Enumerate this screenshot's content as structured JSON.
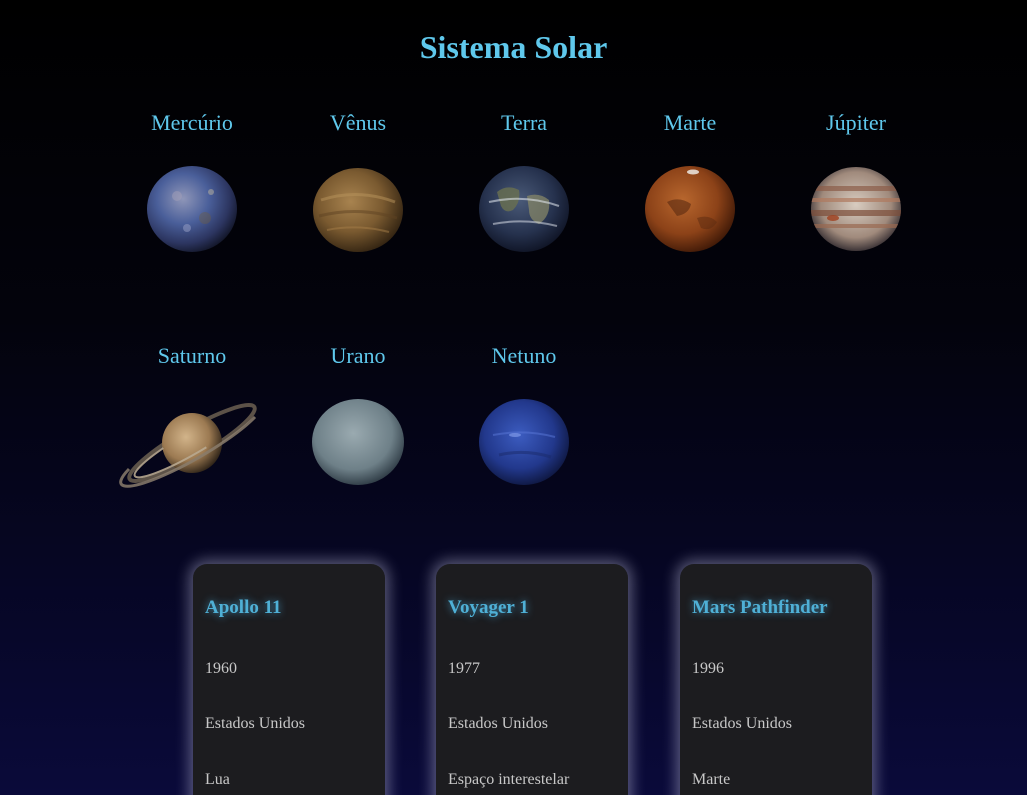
{
  "page": {
    "title": "Sistema Solar"
  },
  "planets": [
    {
      "name": "Mercúrio",
      "icon": "mercury-icon"
    },
    {
      "name": "Vênus",
      "icon": "venus-icon"
    },
    {
      "name": "Terra",
      "icon": "earth-icon"
    },
    {
      "name": "Marte",
      "icon": "mars-icon"
    },
    {
      "name": "Júpiter",
      "icon": "jupiter-icon"
    },
    {
      "name": "Saturno",
      "icon": "saturn-icon"
    },
    {
      "name": "Urano",
      "icon": "uranus-icon"
    },
    {
      "name": "Netuno",
      "icon": "neptune-icon"
    }
  ],
  "missions": [
    {
      "name": "Apollo 11",
      "year": "1960",
      "country": "Estados Unidos",
      "destination": "Lua"
    },
    {
      "name": "Voyager 1",
      "year": "1977",
      "country": "Estados Unidos",
      "destination": "Espaço interestelar"
    },
    {
      "name": "Mars Pathfinder",
      "year": "1996",
      "country": "Estados Unidos",
      "destination": "Marte"
    }
  ],
  "colors": {
    "accent": "#5fc8ec",
    "card_background": "#1c1c1f",
    "card_title": "#4fb0d6",
    "card_text": "#c8c8c8",
    "background": "#000000"
  }
}
